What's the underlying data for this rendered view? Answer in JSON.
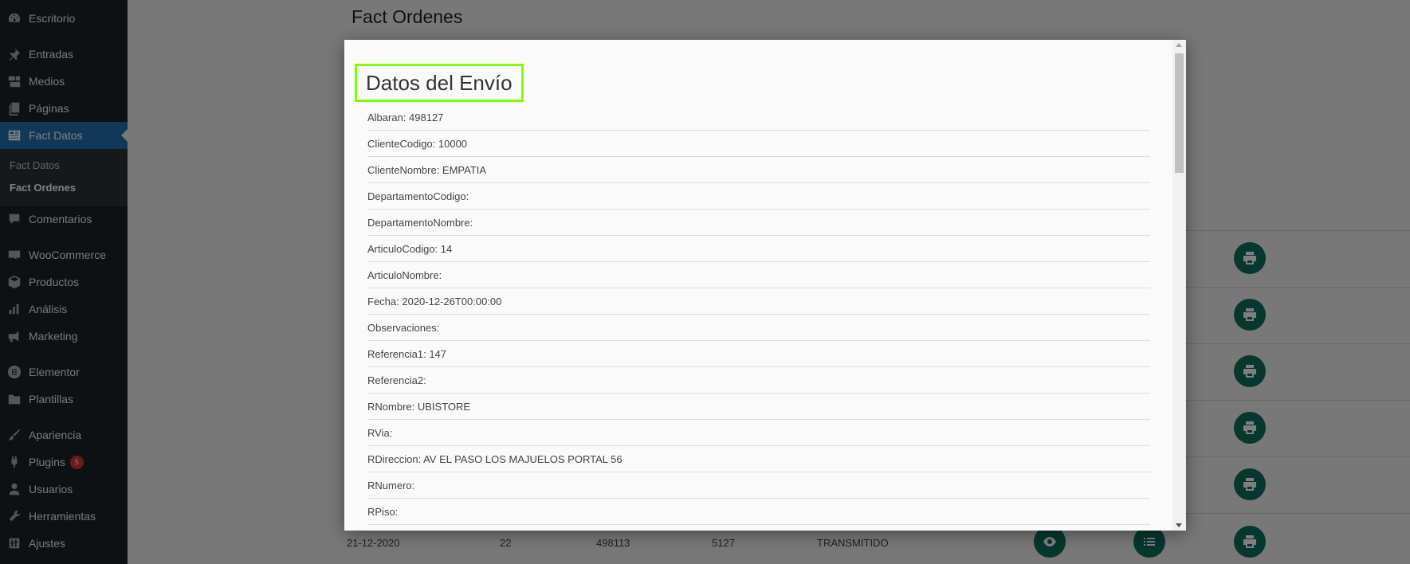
{
  "sidebar": {
    "items": [
      {
        "label": "Escritorio",
        "icon": "dashboard-icon"
      },
      {
        "label": "Entradas",
        "icon": "pin-icon"
      },
      {
        "label": "Medios",
        "icon": "media-icon"
      },
      {
        "label": "Páginas",
        "icon": "pages-icon"
      },
      {
        "label": "Fact Datos",
        "icon": "id-card-icon"
      },
      {
        "label": "Comentarios",
        "icon": "comment-icon"
      },
      {
        "label": "WooCommerce",
        "icon": "woo-icon"
      },
      {
        "label": "Productos",
        "icon": "box-icon"
      },
      {
        "label": "Análisis",
        "icon": "chart-bar-icon"
      },
      {
        "label": "Marketing",
        "icon": "megaphone-icon"
      },
      {
        "label": "Elementor",
        "icon": "elementor-icon"
      },
      {
        "label": "Plantillas",
        "icon": "folder-icon"
      },
      {
        "label": "Apariencia",
        "icon": "brush-icon"
      },
      {
        "label": "Plugins",
        "icon": "plug-icon",
        "badge": "5"
      },
      {
        "label": "Usuarios",
        "icon": "user-icon"
      },
      {
        "label": "Herramientas",
        "icon": "wrench-icon"
      },
      {
        "label": "Ajustes",
        "icon": "sliders-icon"
      }
    ],
    "submenu": [
      "Fact Datos",
      "Fact Ordenes"
    ],
    "accent_color": "#2271b1"
  },
  "page": {
    "title": "Fact Ordenes",
    "last_row": {
      "fecha": "21-12-2020",
      "col2": "22",
      "albaran": "498113",
      "col4": "5127",
      "estado": "TRANSMITIDO"
    },
    "button_color": "#0f6f5f"
  },
  "modal": {
    "heading": "Datos del Envío",
    "highlight_color": "#7fff00",
    "fields": [
      "Albaran: 498127",
      "ClienteCodigo: 10000",
      "ClienteNombre: EMPATIA",
      "DepartamentoCodigo:",
      "DepartamentoNombre:",
      "ArticuloCodigo: 14",
      "ArticuloNombre:",
      "Fecha: 2020-12-26T00:00:00",
      "Observaciones:",
      "Referencia1: 147",
      "Referencia2:",
      "RNombre: UBISTORE",
      "RVia:",
      "RDireccion: AV EL PASO LOS MAJUELOS PORTAL 56",
      "RNumero:",
      "RPiso:"
    ]
  }
}
